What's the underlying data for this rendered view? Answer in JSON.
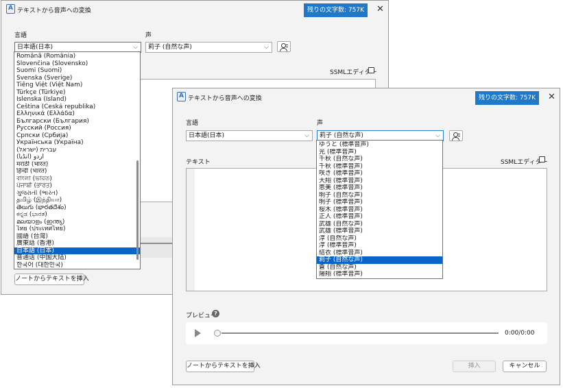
{
  "back": {
    "title": "テキストから音声への変換",
    "char_badge": "残りの文字数: 757K",
    "close": "✕",
    "language_label": "言語",
    "voice_label": "声",
    "language_value": "日本語(日本)",
    "voice_value": "莉子 (自然な声)",
    "ssml_label": "SSMLエディター",
    "insert_note_button": "ノートからテキストを挿入",
    "language_options": [
      "Română (România)",
      "Slovenčina (Slovensko)",
      "Suomi (Suomi)",
      "Svenska (Sverige)",
      "Tiếng Việt (Việt Nam)",
      "Türkçe (Türkiye)",
      "Íslenska (Ísland)",
      "Čeština (Česká republika)",
      "Ελληνικά (Ελλάδα)",
      "Български (България)",
      "Русский (Россия)",
      "Српски (Србија)",
      "Українська (Україна)",
      "עברית (ישראל)",
      "اردو (انڈیا)",
      "मराठी (भारत)",
      "हिन्दी (भारत)",
      "বাংলা (ভারত)",
      "ਪੰਜਾਬੀ (ਭਾਰਤ)",
      "ગુજરાતી (ભારત)",
      "தமிழ் (இந்தியா)",
      "తెలుగు (భారతదేశం)",
      "ಕನ್ನಡ (ಭಾರತ)",
      "മലയാളം (ഇന്ത്യ)",
      "ไทย (ประเทศไทย)",
      "國語 (台灣)",
      "廣東話 (香港)",
      "日本語 (日本)",
      "普通话 (中国大陆)",
      "한국어 (대한민국)"
    ],
    "language_selected_index": 27
  },
  "front": {
    "title": "テキストから音声への変換",
    "char_badge": "残りの文字数: 757K",
    "close": "✕",
    "language_label": "言語",
    "voice_label": "声",
    "language_value": "日本語(日本)",
    "voice_value": "莉子 (自然な声)",
    "text_label": "テキスト",
    "ssml_label": "SSMLエディター",
    "voice_options": [
      "ゆうと (標準音声)",
      "光 (標準音声)",
      "千秋 (自然な声)",
      "千秋 (標準音声)",
      "咲き (標準音声)",
      "大翔 (標準音声)",
      "恵美 (標準音声)",
      "明子 (自然な声)",
      "明子 (標準音声)",
      "桜木 (標準音声)",
      "正人 (標準音声)",
      "武雄 (自然な声)",
      "武雄 (標準音声)",
      "淳 (自然な声)",
      "淳 (標準音声)",
      "結衣 (標準音声)",
      "莉子 (自然な声)",
      "蒼 (自然な声)",
      "陽翔 (標準音声)"
    ],
    "voice_selected_index": 16,
    "preview_label": "プレビュー",
    "help": "?",
    "time": "0:00/0:00",
    "insert_note_button": "ノートからテキストを挿入",
    "insert_button": "挿入",
    "cancel_button": "キャンセル"
  },
  "colors": {
    "accent": "#1f78c8",
    "selection": "#0a64c8"
  }
}
